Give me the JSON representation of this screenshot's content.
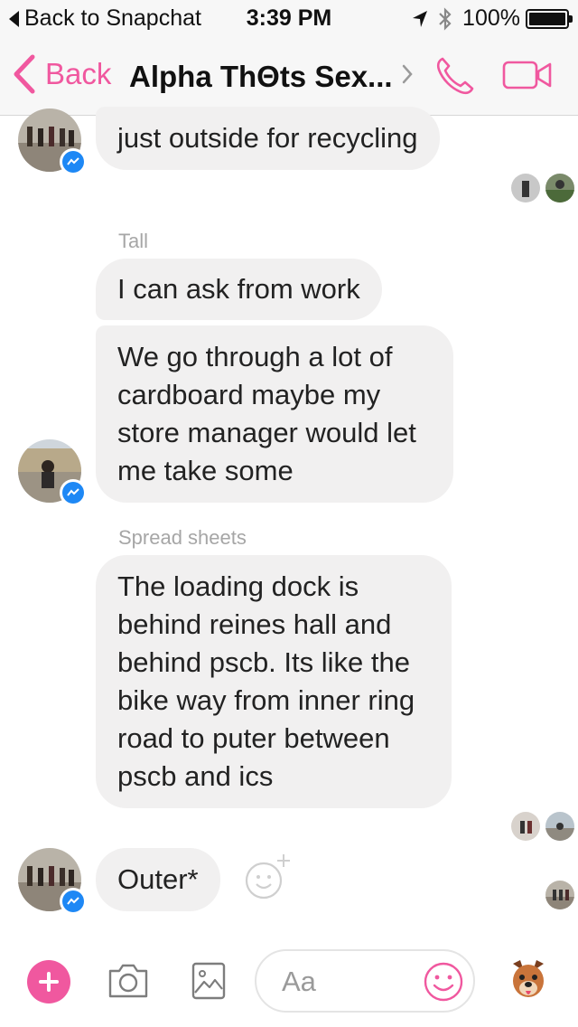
{
  "status_bar": {
    "back_app": "Back to Snapchat",
    "time": "3:39 PM",
    "battery": "100%"
  },
  "nav": {
    "back_label": "Back",
    "title": "Alpha ThΘts Sex...",
    "accent_color": "#f0589f"
  },
  "messages": {
    "m1": "just outside for recycling",
    "sender_tall": "Tall",
    "m2": "I can ask from work",
    "m3_lines": [
      "We go through a lot of",
      "cardboard maybe my",
      "store manager would let",
      "me take some"
    ],
    "sender_spread": "Spread sheets",
    "m4_lines": [
      "The loading dock is",
      "behind reines hall and",
      "behind pscb. Its like the",
      "bike way from inner ring",
      "road to puter between",
      "pscb and ics"
    ],
    "m5": "Outer*"
  },
  "composer": {
    "placeholder": "Aa"
  },
  "icons": {
    "back": "chevron-left-icon",
    "info": "chevron-right-icon",
    "call": "phone-icon",
    "video": "video-camera-icon",
    "add": "plus-icon",
    "camera": "camera-icon",
    "gallery": "image-icon",
    "emoji": "smiley-icon",
    "react": "add-reaction-icon",
    "sticker": "dog-sticker-icon",
    "messenger_badge": "messenger-icon"
  }
}
